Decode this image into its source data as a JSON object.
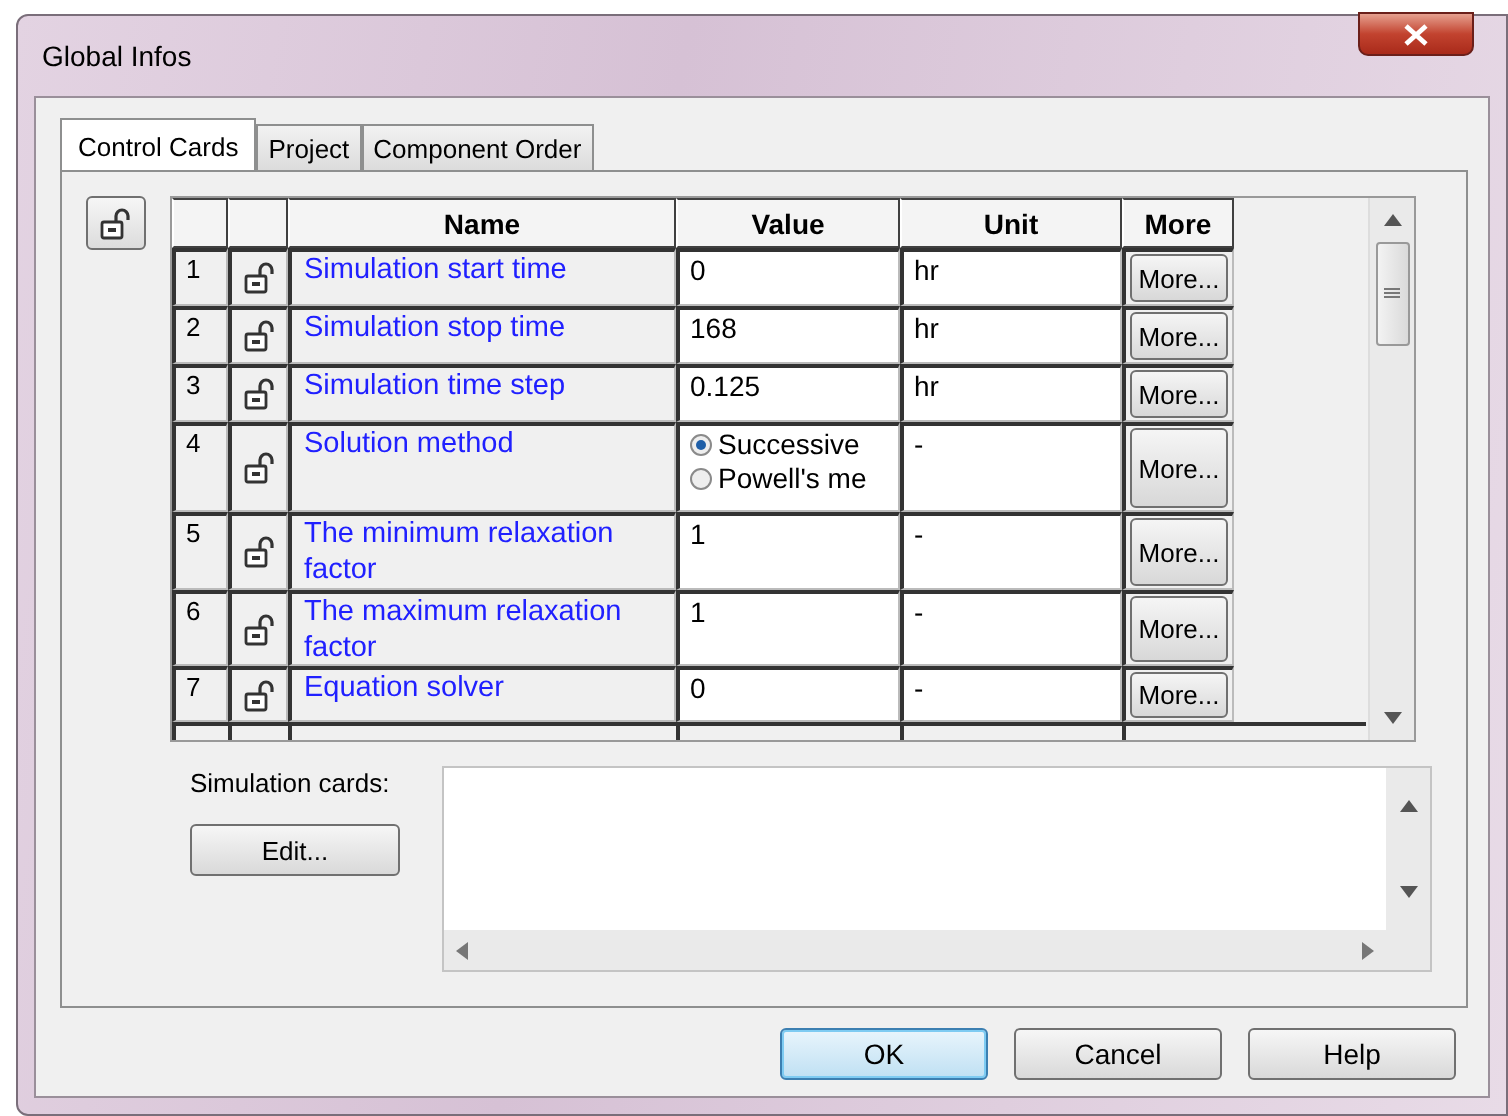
{
  "window": {
    "title": "Global Infos"
  },
  "tabs": [
    {
      "label": "Control Cards",
      "selected": true
    },
    {
      "label": "Project",
      "selected": false
    },
    {
      "label": "Component Order",
      "selected": false
    }
  ],
  "table": {
    "columns": [
      "Name",
      "Value",
      "Unit",
      "More"
    ],
    "rows": [
      {
        "number": "1",
        "name": "Simulation start time",
        "value": {
          "kind": "text",
          "text": "0"
        },
        "unit": "hr",
        "more": "More..."
      },
      {
        "number": "2",
        "name": "Simulation stop time",
        "value": {
          "kind": "text",
          "text": "168"
        },
        "unit": "hr",
        "more": "More..."
      },
      {
        "number": "3",
        "name": "Simulation time step",
        "value": {
          "kind": "text",
          "text": "0.125"
        },
        "unit": "hr",
        "more": "More..."
      },
      {
        "number": "4",
        "name": "Solution method",
        "value": {
          "kind": "radio",
          "options": [
            {
              "label": "Successive",
              "selected": true
            },
            {
              "label": "Powell's me",
              "selected": false
            }
          ]
        },
        "unit": "-",
        "more": "More..."
      },
      {
        "number": "5",
        "name": "The minimum relaxation factor",
        "value": {
          "kind": "text",
          "text": "1"
        },
        "unit": "-",
        "more": "More..."
      },
      {
        "number": "6",
        "name": "The maximum relaxation factor",
        "value": {
          "kind": "text",
          "text": "1"
        },
        "unit": "-",
        "more": "More..."
      },
      {
        "number": "7",
        "name": "Equation solver",
        "value": {
          "kind": "text",
          "text": "0"
        },
        "unit": "-",
        "more": "More..."
      }
    ]
  },
  "simulation_cards": {
    "label": "Simulation cards:",
    "edit_button": "Edit..."
  },
  "buttons": [
    {
      "label": "OK",
      "kind": "default"
    },
    {
      "label": "Cancel",
      "kind": "normal"
    },
    {
      "label": "Help",
      "kind": "normal"
    }
  ]
}
